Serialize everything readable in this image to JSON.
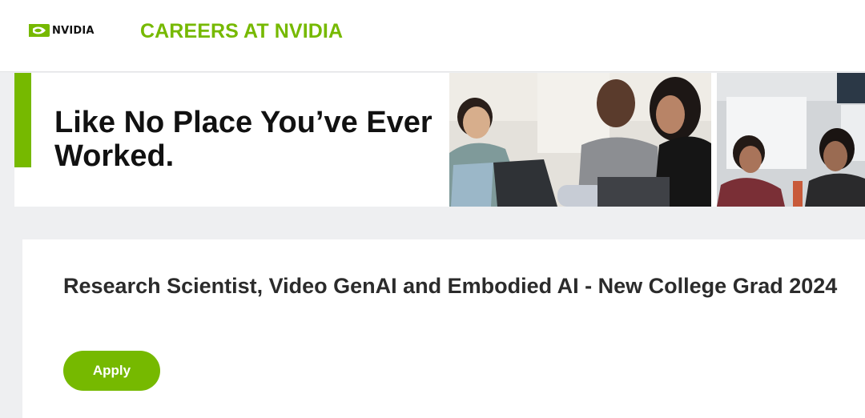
{
  "header": {
    "logo_text": "NVIDIA",
    "careers_title": "CAREERS AT NVIDIA",
    "brand_color": "#76b900"
  },
  "banner": {
    "headline": "Like No Place You’ve Ever Worked."
  },
  "job": {
    "title": "Research Scientist, Video GenAI and Embodied AI - New College Grad 2024",
    "apply_label": "Apply"
  }
}
